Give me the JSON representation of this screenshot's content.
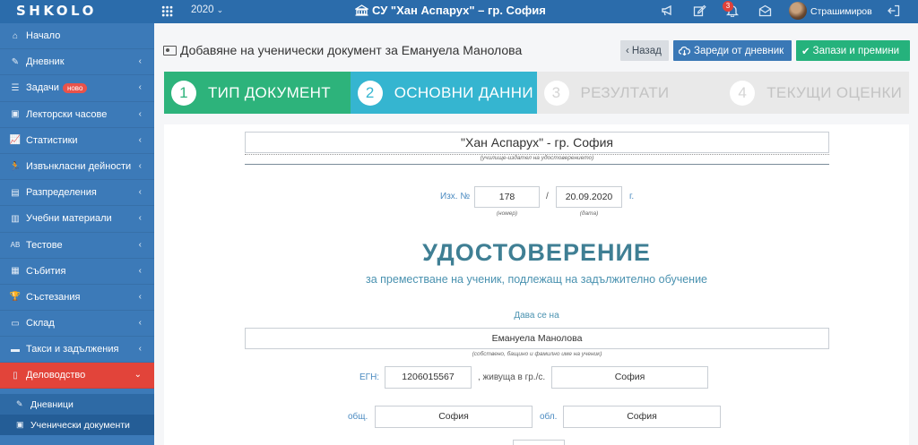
{
  "topbar": {
    "logo": "SHKOLO",
    "year": "2020",
    "school": "СУ \"Хан Аспарух\" – гр. София",
    "notifications_count": "3",
    "username": "Страшимиров",
    "icons": [
      "grid-icon",
      "megaphone-icon",
      "edit-icon",
      "bell-icon",
      "envelope-icon",
      "logout-icon"
    ]
  },
  "sidebar": {
    "items": [
      {
        "label": "Начало",
        "icon": "home-icon"
      },
      {
        "label": "Дневник",
        "icon": "journal-icon"
      },
      {
        "label": "Задачи",
        "icon": "tasks-icon",
        "badge": "ново"
      },
      {
        "label": "Лекторски часове",
        "icon": "briefcase-icon"
      },
      {
        "label": "Статистики",
        "icon": "chart-icon"
      },
      {
        "label": "Извънкласни дейности",
        "icon": "running-icon"
      },
      {
        "label": "Разпределения",
        "icon": "list-icon"
      },
      {
        "label": "Учебни материали",
        "icon": "books-icon"
      },
      {
        "label": "Тестове",
        "icon": "abc-icon"
      },
      {
        "label": "Събития",
        "icon": "calendar-icon"
      },
      {
        "label": "Състезания",
        "icon": "trophy-icon"
      },
      {
        "label": "Склад",
        "icon": "box-icon"
      },
      {
        "label": "Такси и задължения",
        "icon": "money-icon"
      },
      {
        "label": "Деловодство",
        "icon": "document-icon",
        "active": true
      }
    ],
    "sub_items": [
      {
        "label": "Дневници",
        "icon": "edit-icon"
      },
      {
        "label": "Ученически документи",
        "icon": "id-card-icon"
      }
    ]
  },
  "header": {
    "title": "Добавяне на ученически документ за Емануела Манолова",
    "back_label": "Назад",
    "load_label": "Зареди от дневник",
    "save_label": "Запази и премини"
  },
  "steps": [
    {
      "num": "1",
      "label": "ТИП ДОКУМЕНТ"
    },
    {
      "num": "2",
      "label": "ОСНОВНИ ДАННИ"
    },
    {
      "num": "3",
      "label": "РЕЗУЛТАТИ"
    },
    {
      "num": "4",
      "label": "ТЕКУЩИ ОЦЕНКИ"
    }
  ],
  "document": {
    "issuer": "\"Хан Аспарух\" - гр. София",
    "issuer_caption": "(училище-издател на удостоверението)",
    "reg_label": "Изх. №",
    "reg_number": "178",
    "reg_number_caption": "(номер)",
    "separator": "/",
    "date": "20.09.2020",
    "date_caption": "(дата)",
    "year_suffix": "г.",
    "title": "УДОСТОВЕРЕНИЕ",
    "subtitle": "за преместване на ученик, подлежащ на задължително обучение",
    "given_to_label": "Дава се на",
    "student_name": "Емануела  Манолова",
    "student_name_caption": "(собствено, бащино и фамилно име на ученик)",
    "egn_label": "ЕГН:",
    "egn": "1206015567",
    "living_label": ", живуща в гр./с.",
    "city": "София",
    "municipality_label": "общ.",
    "municipality": "София",
    "region_label": "обл.",
    "region": "София"
  },
  "colors": {
    "topbar": "#2b6cab",
    "sidebar": "#3c7ab8",
    "active_item": "#e2443a",
    "step_done": "#2db37b",
    "step_current": "#35b5d0",
    "save_button": "#25b27c",
    "load_button": "#3a78b6",
    "title": "#3f7f94"
  }
}
